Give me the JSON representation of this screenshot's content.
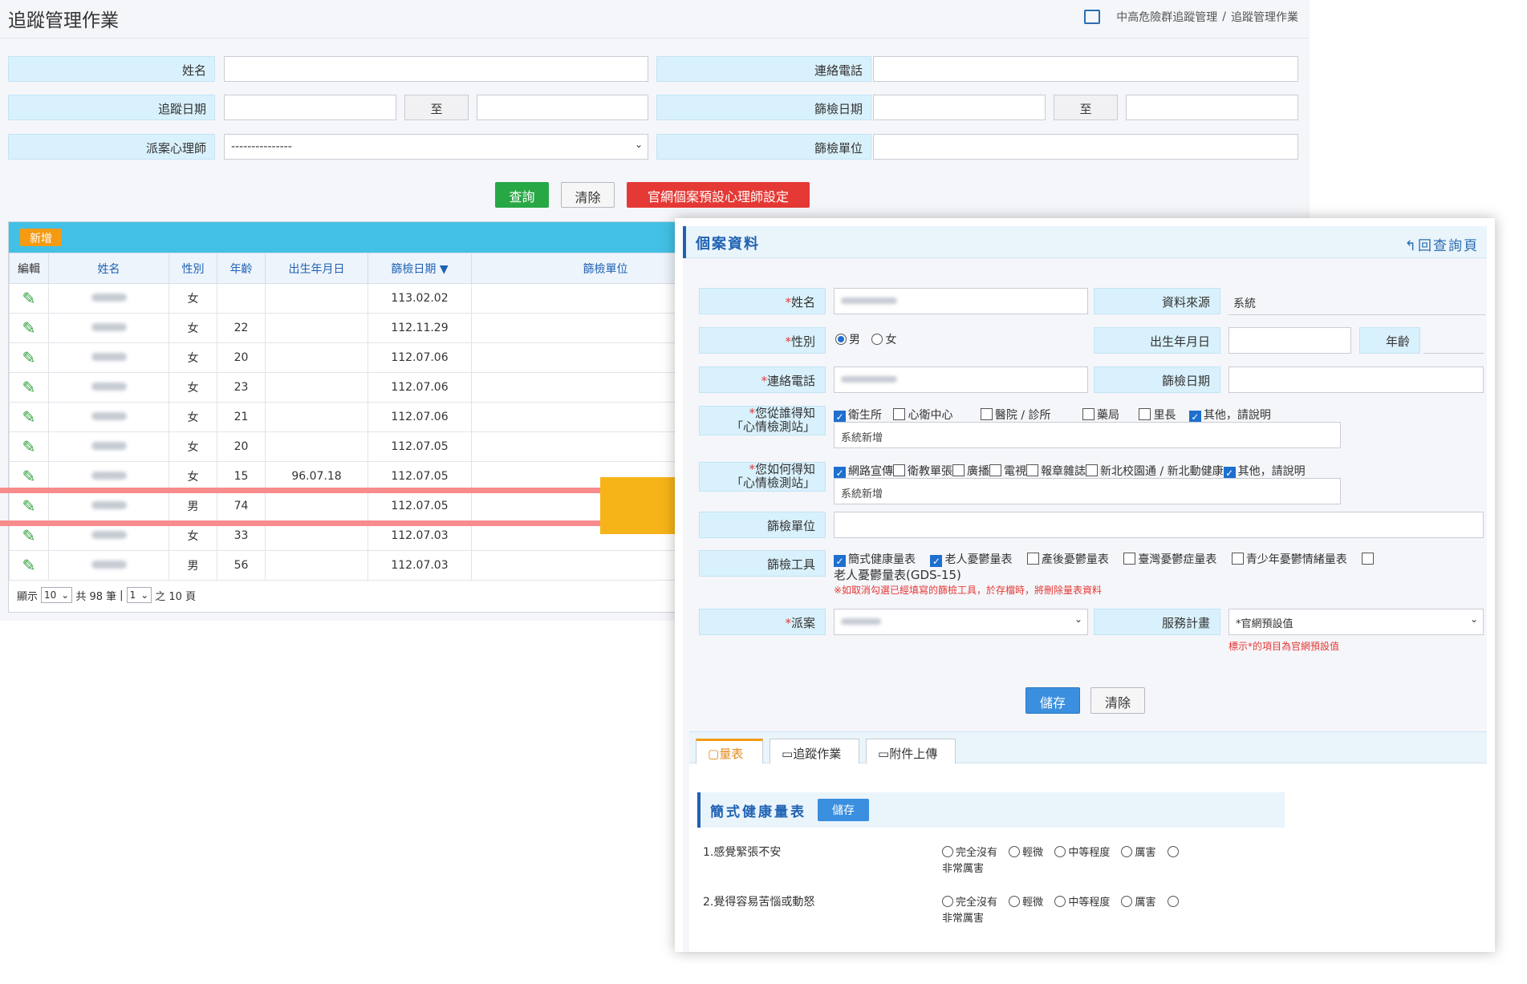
{
  "header": {
    "title": "追蹤管理作業",
    "breadcrumb": [
      "中高危險群追蹤管理",
      "追蹤管理作業"
    ]
  },
  "search": {
    "name_label": "姓名",
    "phone_label": "連絡電話",
    "track_date_label": "追蹤日期",
    "screen_date_label": "篩檢日期",
    "to_label": "至",
    "psychologist_label": "派案心理師",
    "psychologist_value": "---------------",
    "screen_unit_label": "篩檢單位",
    "query_button": "查詢",
    "clear_button": "清除",
    "default_psych_button": "官網個案預設心理師設定"
  },
  "grid": {
    "add_button": "新增",
    "columns": [
      "編輯",
      "姓名",
      "性別",
      "年齡",
      "出生年月日",
      "篩檢日期 ▼",
      "篩檢單位"
    ],
    "rows": [
      {
        "gender": "女",
        "age": "",
        "birth": "",
        "date": "113.02.02"
      },
      {
        "gender": "女",
        "age": "22",
        "birth": "",
        "date": "112.11.29"
      },
      {
        "gender": "女",
        "age": "20",
        "birth": "",
        "date": "112.07.06"
      },
      {
        "gender": "女",
        "age": "23",
        "birth": "",
        "date": "112.07.06"
      },
      {
        "gender": "女",
        "age": "21",
        "birth": "",
        "date": "112.07.06"
      },
      {
        "gender": "女",
        "age": "20",
        "birth": "",
        "date": "112.07.05"
      },
      {
        "gender": "女",
        "age": "15",
        "birth": "96.07.18",
        "date": "112.07.05"
      },
      {
        "gender": "男",
        "age": "74",
        "birth": "",
        "date": "112.07.05"
      },
      {
        "gender": "女",
        "age": "33",
        "birth": "",
        "date": "112.07.03"
      },
      {
        "gender": "男",
        "age": "56",
        "birth": "",
        "date": "112.07.03"
      }
    ],
    "pager": {
      "show": "顯示",
      "page_size": "10",
      "total": "共 98 筆",
      "page": "1",
      "of_pages": "之 10 頁"
    }
  },
  "panel": {
    "title": "個案資料",
    "back_link": "回查詢頁",
    "name_label": "姓名",
    "source_label": "資料來源",
    "source_value": "系統",
    "gender_label": "性別",
    "gender_male": "男",
    "gender_female": "女",
    "birth_label": "出生年月日",
    "age_label": "年齡",
    "phone_label": "連絡電話",
    "screen_date_label": "篩檢日期",
    "who_label_1": "您從誰得知",
    "who_label_2": "「心情檢測站」",
    "who_options": [
      "衛生所",
      "心衛中心",
      "醫院 / 診所",
      "藥局",
      "里長",
      "其他，請說明"
    ],
    "who_other_value": "系統新增",
    "how_label_1": "您如何得知",
    "how_label_2": "「心情檢測站」",
    "how_options": [
      "網路宣傳",
      "衛教單張",
      "廣播",
      "電視",
      "報章雜誌",
      "新北校園通 / 新北動健康",
      "其他，請說明"
    ],
    "how_other_value": "系統新增",
    "unit_label": "篩檢單位",
    "tool_label": "篩檢工具",
    "tool_options": [
      "簡式健康量表",
      "老人憂鬱量表",
      "產後憂鬱量表",
      "臺灣憂鬱症量表",
      "青少年憂鬱情緒量表"
    ],
    "tool_extra": "老人憂鬱量表(GDS-15)",
    "tool_note": "※如取消勾選已經填寫的篩檢工具，於存檔時，將刪除量表資料",
    "assign_label": "派案",
    "service_label": "服務計畫",
    "service_value": "*官網預設值",
    "service_note": "標示*的項目為官網預設值",
    "save_button": "儲存",
    "clear_button": "清除",
    "tabs": [
      "量表",
      "追蹤作業",
      "附件上傳"
    ],
    "section_title": "簡式健康量表",
    "section_save": "儲存",
    "questions": [
      "1.感覺緊張不安",
      "2.覺得容易苦惱或動怒"
    ],
    "answer_options": [
      "完全沒有",
      "輕微",
      "中等程度",
      "厲害"
    ],
    "answer_last": "非常厲害"
  },
  "colors": {
    "accent": "#1f62b3",
    "arrow": "#f7b418",
    "highlight": "#f88c8c",
    "query_green": "#28a745",
    "danger_red": "#e53935",
    "add_orange": "#f59a13",
    "grid_bar": "#43c0e6"
  }
}
